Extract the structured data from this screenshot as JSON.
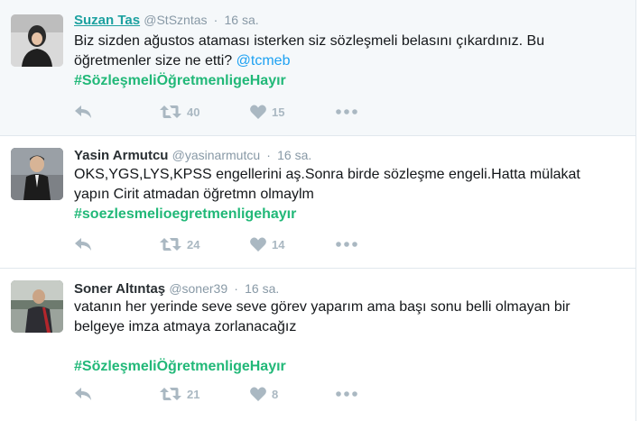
{
  "tweets": [
    {
      "name": "Suzan Tas",
      "handle": "@StSzntas",
      "separator": "·",
      "time": "16 sa.",
      "text_before": "Biz sizden ağustos ataması isterken siz sözleşmeli belasını çıkardınız. Bu öğretmenler size ne etti? ",
      "mention": "@tcmeb",
      "hashtag": "#SözleşmeliÖğretmenligeHayır",
      "retweets": "40",
      "likes": "15"
    },
    {
      "name": "Yasin Armutcu",
      "handle": "@yasinarmutcu",
      "separator": "·",
      "time": "16 sa.",
      "text": "OKS,YGS,LYS,KPSS engellerini aş.Sonra birde sözleşme engeli.Hatta mülakat yapın Cirit atmadan öğretmn olmaylm",
      "hashtag": "#soezlesmelioegretmenligehayır",
      "retweets": "24",
      "likes": "14"
    },
    {
      "name": "Soner Altıntaş",
      "handle": "@soner39",
      "separator": "·",
      "time": "16 sa.",
      "text": "vatanın her yerinde seve seve görev yaparım ama başı sonu belli olmayan bir belgeye imza atmaya zorlanacağız",
      "hashtag": "#SözleşmeliÖğretmenligeHayır",
      "retweets": "21",
      "likes": "8"
    }
  ],
  "icons": {
    "reply": "reply-icon",
    "retweet": "retweet-icon",
    "like": "heart-icon",
    "more": "more-icon"
  },
  "colors": {
    "hashtag": "#21b878",
    "mention": "#1da1f2",
    "muted": "#8899a6",
    "action": "#aab8c2",
    "hover_bg": "#f5f8fa"
  }
}
